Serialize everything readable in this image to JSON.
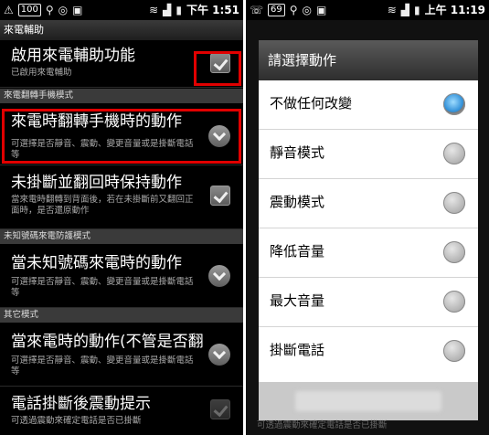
{
  "left": {
    "status_bar": {
      "battery": "100",
      "time": "下午 1:51"
    },
    "app_title": "來電輔助",
    "items": [
      {
        "title": "啟用來電輔助功能",
        "summary": "已啟用來電輔助",
        "control": "checkbox",
        "checked": true
      },
      {
        "section": "來電翻轉手機模式"
      },
      {
        "title": "來電時翻轉手機時的動作",
        "summary": "可選擇是否靜音、震動、變更音量或是掛斷電話等",
        "control": "chevron"
      },
      {
        "title": "未掛斷並翻回時保持動作",
        "summary": "當來電時翻轉到背面後，若在未掛斷前又翻回正面時，是否還原動作",
        "control": "checkbox",
        "checked": true
      },
      {
        "section": "未知號碼來電防護模式"
      },
      {
        "title": "當未知號碼來電時的動作",
        "summary": "可選擇是否靜音、震動、變更音量或是掛斷電話等",
        "control": "chevron"
      },
      {
        "section": "其它模式"
      },
      {
        "title": "當來電時的動作(不管是否翻",
        "summary": "可選擇是否靜音、震動、變更音量或是掛斷電話等",
        "control": "chevron"
      },
      {
        "title": "電話掛斷後震動提示",
        "summary": "可透過震動來確定電話是否已掛斷",
        "control": "checkbox",
        "checked": true
      }
    ]
  },
  "right": {
    "status_bar": {
      "battery": "69",
      "time": "上午 11:19"
    },
    "dialog": {
      "title": "請選擇動作",
      "options": [
        {
          "label": "不做任何改變",
          "selected": true
        },
        {
          "label": "靜音模式",
          "selected": false
        },
        {
          "label": "震動模式",
          "selected": false
        },
        {
          "label": "降低音量",
          "selected": false
        },
        {
          "label": "最大音量",
          "selected": false
        },
        {
          "label": "掛斷電話",
          "selected": false
        }
      ]
    },
    "background_text": "可透過震動來確定電話是否已掛斷"
  },
  "colors": {
    "highlight": "#e10000",
    "selected_radio": "#2f8fd8"
  }
}
